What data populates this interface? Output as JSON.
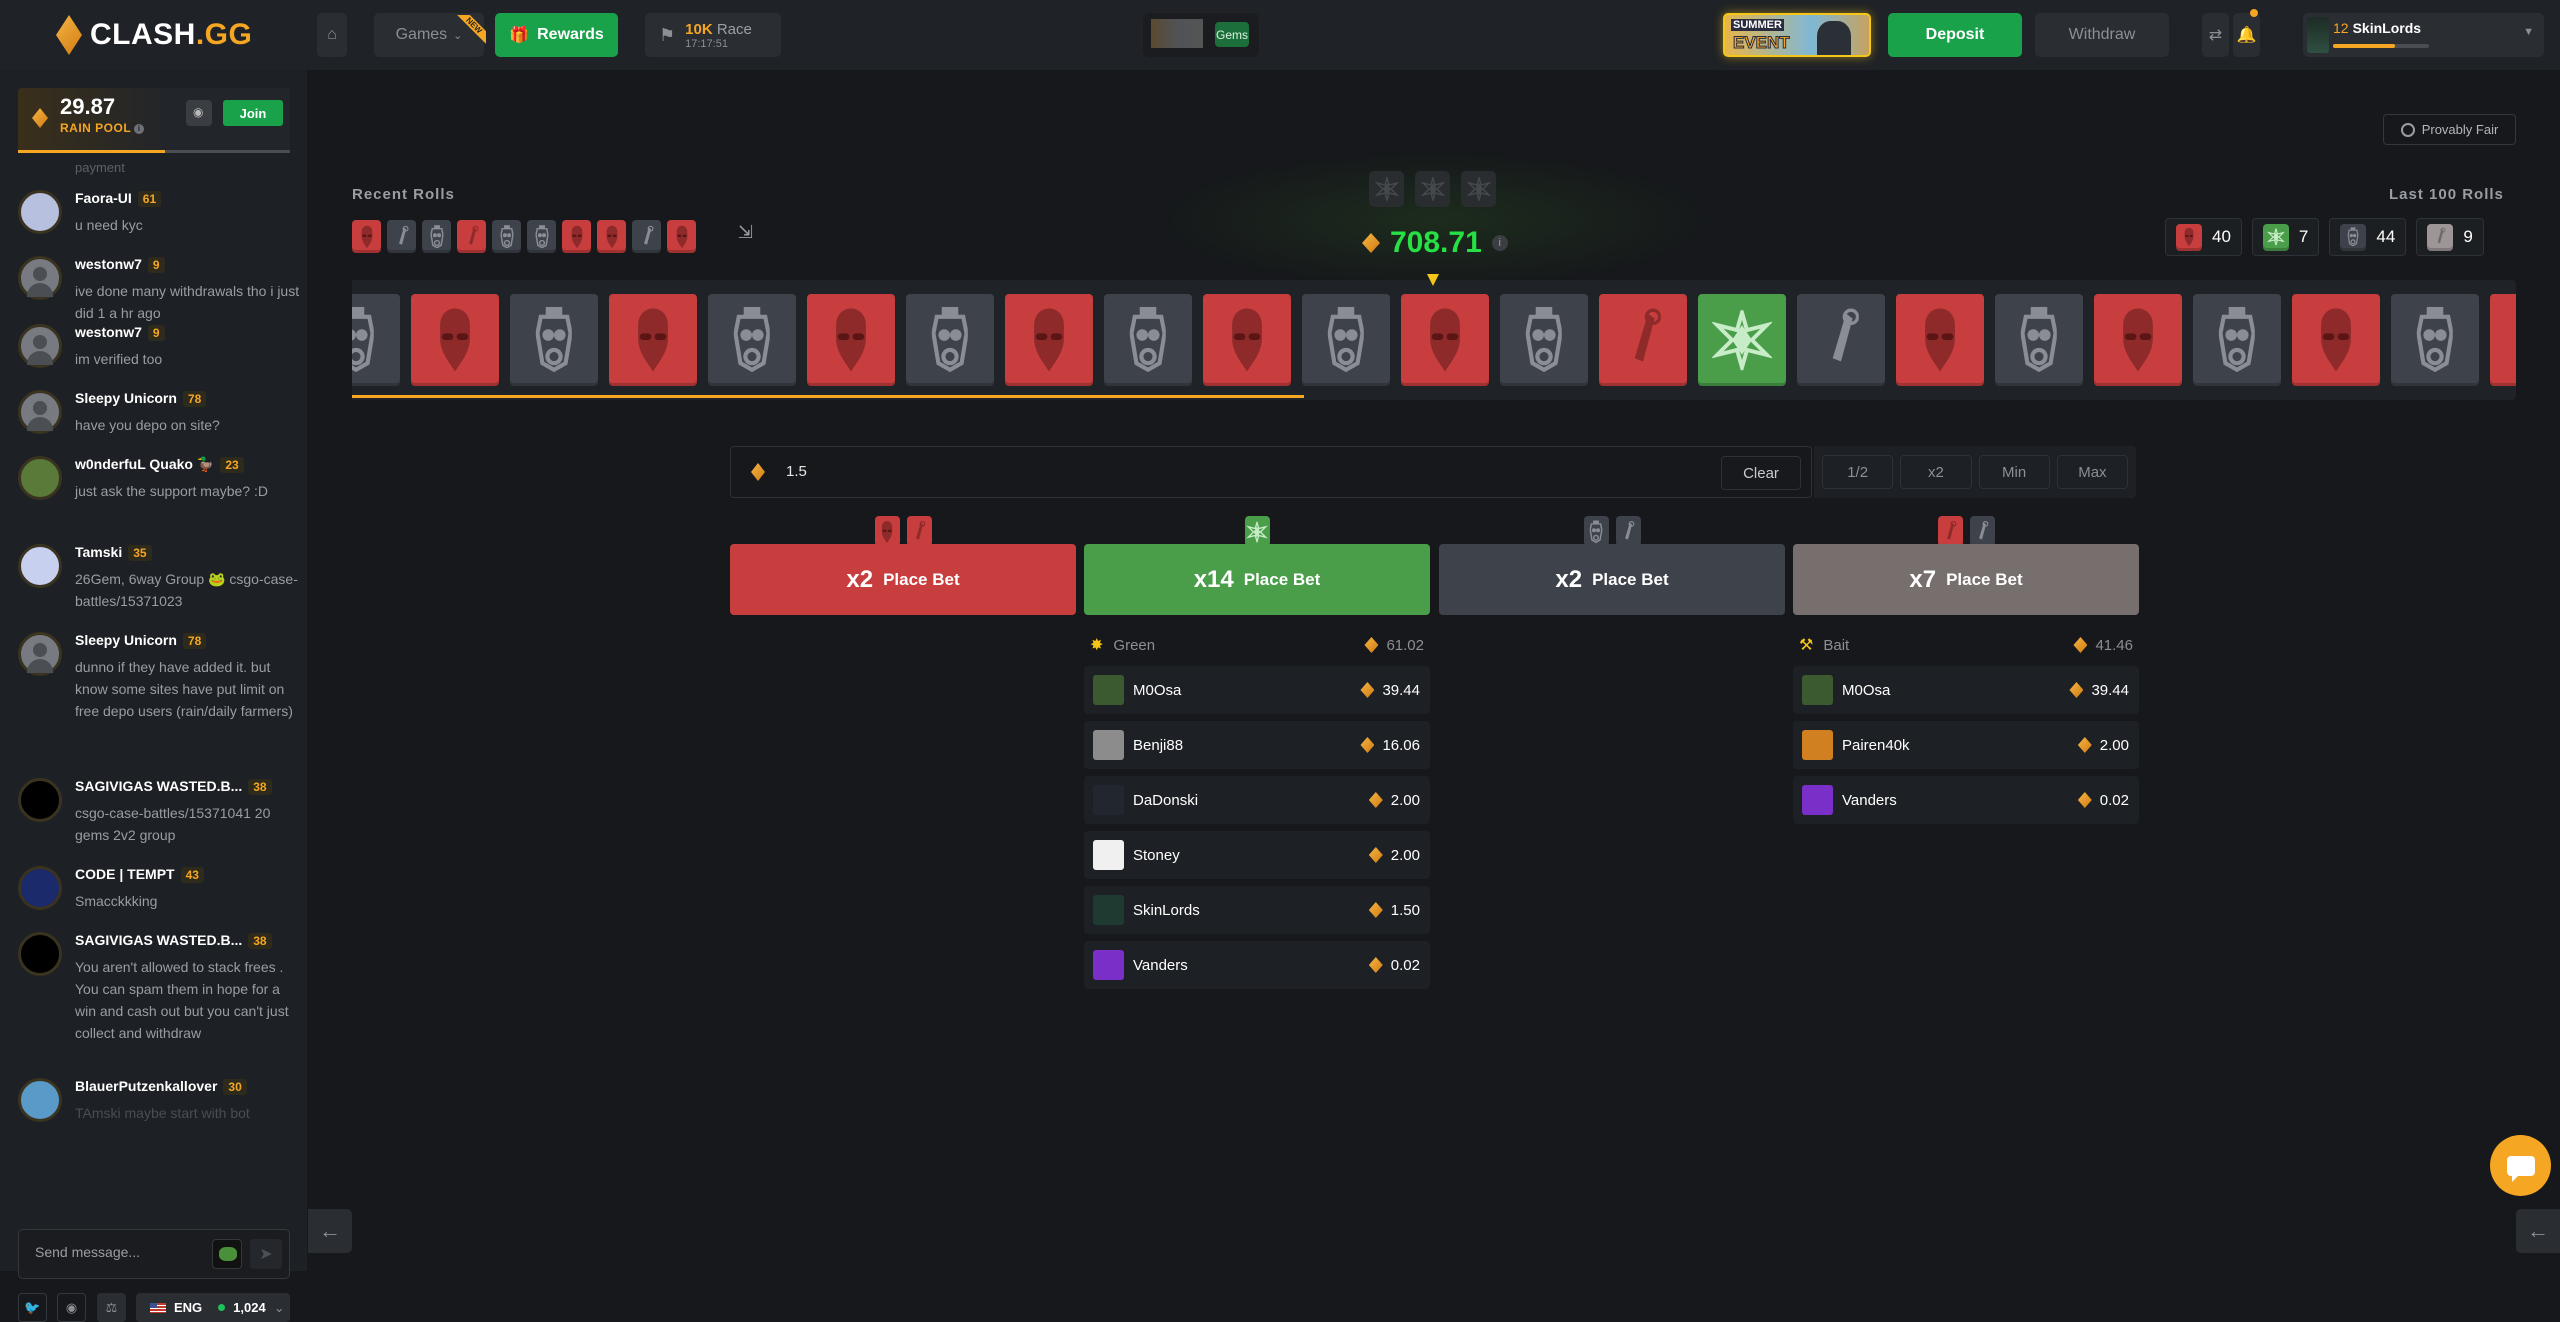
{
  "header": {
    "logo_main": "CLASH",
    "logo_suffix": ".GG",
    "games_label": "Games",
    "games_badge": "NEW",
    "rewards_label": "Rewards",
    "race_amount": "10K",
    "race_label": "Race",
    "race_timer": "17:17:51",
    "gems_label": "Gems",
    "event_line1": "SUMMER",
    "event_line2": "EVENT",
    "deposit_label": "Deposit",
    "withdraw_label": "Withdraw",
    "user_level": "12",
    "user_name": "SkinLords",
    "user_xp_fraction": 0.65
  },
  "sidebar": {
    "rain_amount": "29.87",
    "rain_label": "RAIN POOL",
    "rain_join": "Join",
    "rain_progress_fraction": 0.54,
    "chat_fragment": "payment",
    "messages": [
      {
        "user": "Faora-UI",
        "level": "61",
        "text": "u need kyc"
      },
      {
        "user": "westonw7",
        "level": "9",
        "text": "ive done many withdrawals tho i just did 1 a hr ago"
      },
      {
        "user": "westonw7",
        "level": "9",
        "text": "im verified too"
      },
      {
        "user": "Sleepy Unicorn",
        "level": "78",
        "text": "have you depo on site?"
      },
      {
        "user": "w0nderfuL Quako 🦆",
        "level": "23",
        "text": "just ask the support maybe? :D"
      },
      {
        "user": "Tamski",
        "level": "35",
        "text": "26Gem, 6way Group 🐸 csgo-case-battles/15371023"
      },
      {
        "user": "Sleepy Unicorn",
        "level": "78",
        "text": "dunno if they have added it. but know some sites have put limit on free depo users (rain/daily farmers)"
      },
      {
        "user": "SAGIVIGAS WASTED.B...",
        "level": "38",
        "text": "csgo-case-battles/15371041 20 gems 2v2 group"
      },
      {
        "user": "CODE | TEMPT",
        "level": "43",
        "text": "Smacckkking"
      },
      {
        "user": "SAGIVIGAS WASTED.B...",
        "level": "38",
        "text": "You aren't allowed to stack frees . You can spam them in hope for a win and cash out but you can't just collect and withdraw"
      },
      {
        "user": "BlauerPutzenkallover",
        "level": "30",
        "text": "TAmski maybe start with bot"
      }
    ],
    "chat_placeholder": "Send message...",
    "language": "ENG",
    "online_count": "1,024"
  },
  "main": {
    "provably_fair": "Provably Fair",
    "recent_rolls_title": "Recent Rolls",
    "recent_rolls": [
      "red-ct",
      "grey-bait",
      "grey-t",
      "red-bait",
      "grey-t",
      "grey-t",
      "red-ct",
      "red-ct",
      "grey-bait",
      "red-ct"
    ],
    "jackpot_value": "708.71",
    "last100_title": "Last 100 Rolls",
    "last100": [
      {
        "type": "red-ct",
        "count": "40"
      },
      {
        "type": "green",
        "count": "7"
      },
      {
        "type": "grey-t",
        "count": "44"
      },
      {
        "type": "beige-bait",
        "count": "9"
      }
    ],
    "reel": [
      "grey-t",
      "red-ct",
      "grey-t",
      "red-ct",
      "grey-t",
      "red-ct",
      "grey-t",
      "red-ct",
      "grey-t",
      "red-ct",
      "grey-t",
      "red-ct",
      "grey-t",
      "red-bait",
      "green",
      "grey-bait",
      "red-ct",
      "grey-t",
      "red-ct",
      "grey-t",
      "red-ct",
      "grey-t",
      "red-ct"
    ],
    "reel_progress_fraction": 0.44,
    "bet_amount": "1.5",
    "clear_label": "Clear",
    "modifiers": [
      "1/2",
      "x2",
      "Min",
      "Max"
    ],
    "bet_columns": [
      {
        "multiplier": "x2",
        "label": "Place Bet",
        "color": "#c83e3e",
        "icons": [
          "red-ct",
          "red-bait"
        ],
        "total_name": "",
        "total_amount": "",
        "bets": []
      },
      {
        "multiplier": "x14",
        "label": "Place Bet",
        "color": "#4a9e4a",
        "icons": [
          "green"
        ],
        "total_name": "Green",
        "total_amount": "61.02",
        "bets": [
          {
            "name": "M0Osa",
            "amount": "39.44",
            "avatar": "#3c5a30"
          },
          {
            "name": "Benji88",
            "amount": "16.06",
            "avatar": "#8c8c8c"
          },
          {
            "name": "DaDonski",
            "amount": "2.00",
            "avatar": "#22262e"
          },
          {
            "name": "Stoney",
            "amount": "2.00",
            "avatar": "#f0f0f0"
          },
          {
            "name": "SkinLords",
            "amount": "1.50",
            "avatar": "#1f3a30"
          },
          {
            "name": "Vanders",
            "amount": "0.02",
            "avatar": "#7a2fc8"
          }
        ]
      },
      {
        "multiplier": "x2",
        "label": "Place Bet",
        "color": "#3e424a",
        "icons": [
          "grey-t",
          "grey-bait"
        ],
        "total_name": "",
        "total_amount": "",
        "bets": []
      },
      {
        "multiplier": "x7",
        "label": "Place Bet",
        "color": "#776e6e",
        "icons": [
          "red-bait",
          "grey-bait"
        ],
        "total_name": "Bait",
        "total_amount": "41.46",
        "bets": [
          {
            "name": "M0Osa",
            "amount": "39.44",
            "avatar": "#3c5a30"
          },
          {
            "name": "Pairen40k",
            "amount": "2.00",
            "avatar": "#d08020"
          },
          {
            "name": "Vanders",
            "amount": "0.02",
            "avatar": "#7a2fc8"
          }
        ]
      }
    ]
  }
}
